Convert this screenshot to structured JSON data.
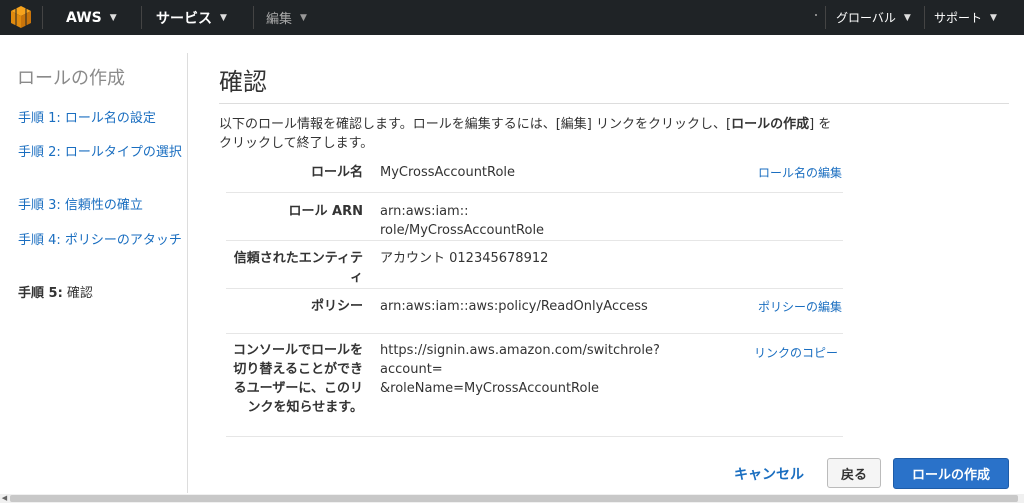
{
  "nav": {
    "aws": "AWS",
    "services": "サービス",
    "edit": "編集",
    "region": "グローバル",
    "support": "サポート",
    "logo_color": "#f7a31c"
  },
  "sidebar": {
    "title": "ロールの作成",
    "steps": [
      {
        "num": "手順 1:",
        "label": " ロール名の設定"
      },
      {
        "num": "手順 2:",
        "label": " ロールタイプの選択"
      },
      {
        "num": "手順 3:",
        "label": " 信頼性の確立"
      },
      {
        "num": "手順 4:",
        "label": " ポリシーのアタッチ"
      },
      {
        "num": "手順 5:",
        "label": " 確認"
      }
    ]
  },
  "main": {
    "title": "確認",
    "intro_1": "以下のロール情報を確認します。ロールを編集するには、[編集] リンクをクリックし、[",
    "intro_bold": "ロールの作成",
    "intro_2": "] をクリックして終了します。",
    "rows": [
      {
        "label": "ロール名",
        "value": "MyCrossAccountRole",
        "link": "ロール名の編集"
      },
      {
        "label": "ロール ARN",
        "value_a": "arn:aws:iam::",
        "value_b": "role/MyCrossAccountRole"
      },
      {
        "label": "信頼されたエンティティ",
        "value": "アカウント 012345678912"
      },
      {
        "label": "ポリシー",
        "value": "arn:aws:iam::aws:policy/ReadOnlyAccess",
        "link": "ポリシーの編集"
      },
      {
        "label": "コンソールでロールを切り替えることができるユーザーに、このリンクを知らせます。",
        "value_a": "https://signin.aws.amazon.com/switchrole?account=",
        "value_b": "&roleName=MyCrossAccountRole",
        "link": "リンクのコピー"
      }
    ]
  },
  "buttons": {
    "cancel": "キャンセル",
    "back": "戻る",
    "create": "ロールの作成"
  }
}
